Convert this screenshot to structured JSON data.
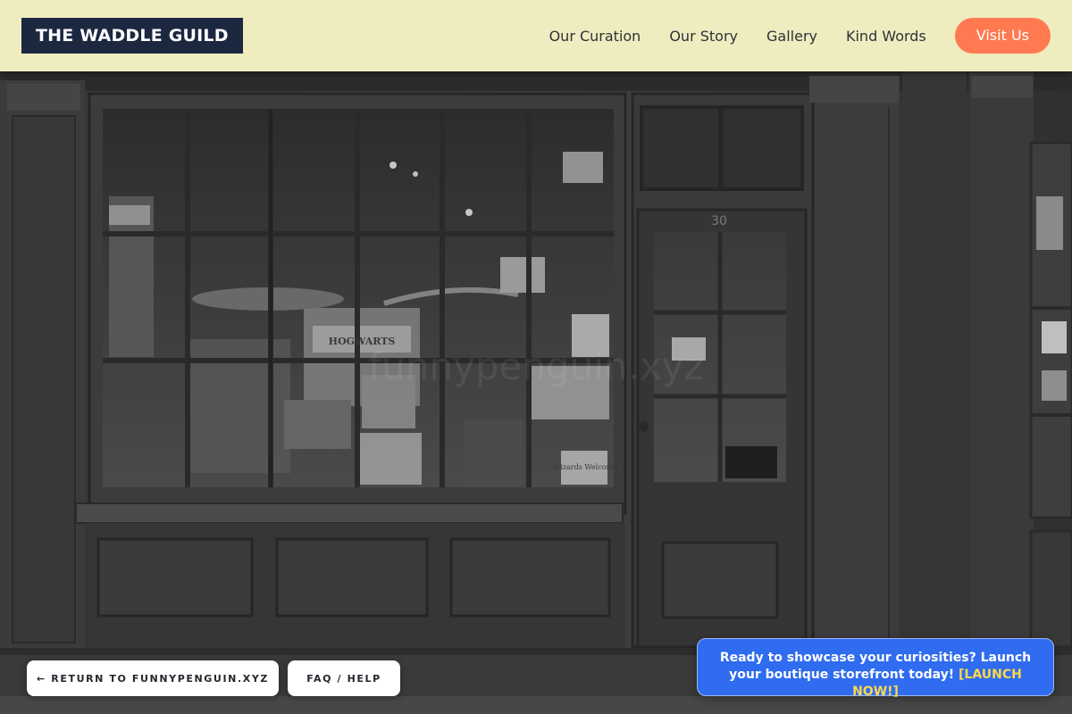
{
  "brand": {
    "name": "THE WADDLE GUILD"
  },
  "nav": {
    "links": [
      {
        "label": "Our Curation"
      },
      {
        "label": "Our Story"
      },
      {
        "label": "Gallery"
      },
      {
        "label": "Kind Words"
      }
    ],
    "cta": "Visit Us"
  },
  "storefront": {
    "door_number": "30",
    "shop_sign": "HOGWARTS",
    "window_sign": "Wizards Welcome",
    "watermark": "funnypenguin.xyz"
  },
  "footer": {
    "return_label": "← RETURN TO FUNNYPENGUIN.XYZ",
    "faq_label": "FAQ / HELP"
  },
  "promo": {
    "text": "Ready to showcase your curiosities? Launch your boutique storefront today!",
    "cta": "[LAUNCH NOW!]"
  },
  "colors": {
    "header_bg": "#efecbf",
    "logo_bg": "#1c2740",
    "accent_orange": "#ff7a50",
    "promo_blue": "#2f6cf0",
    "promo_cta": "#ffd84a"
  }
}
